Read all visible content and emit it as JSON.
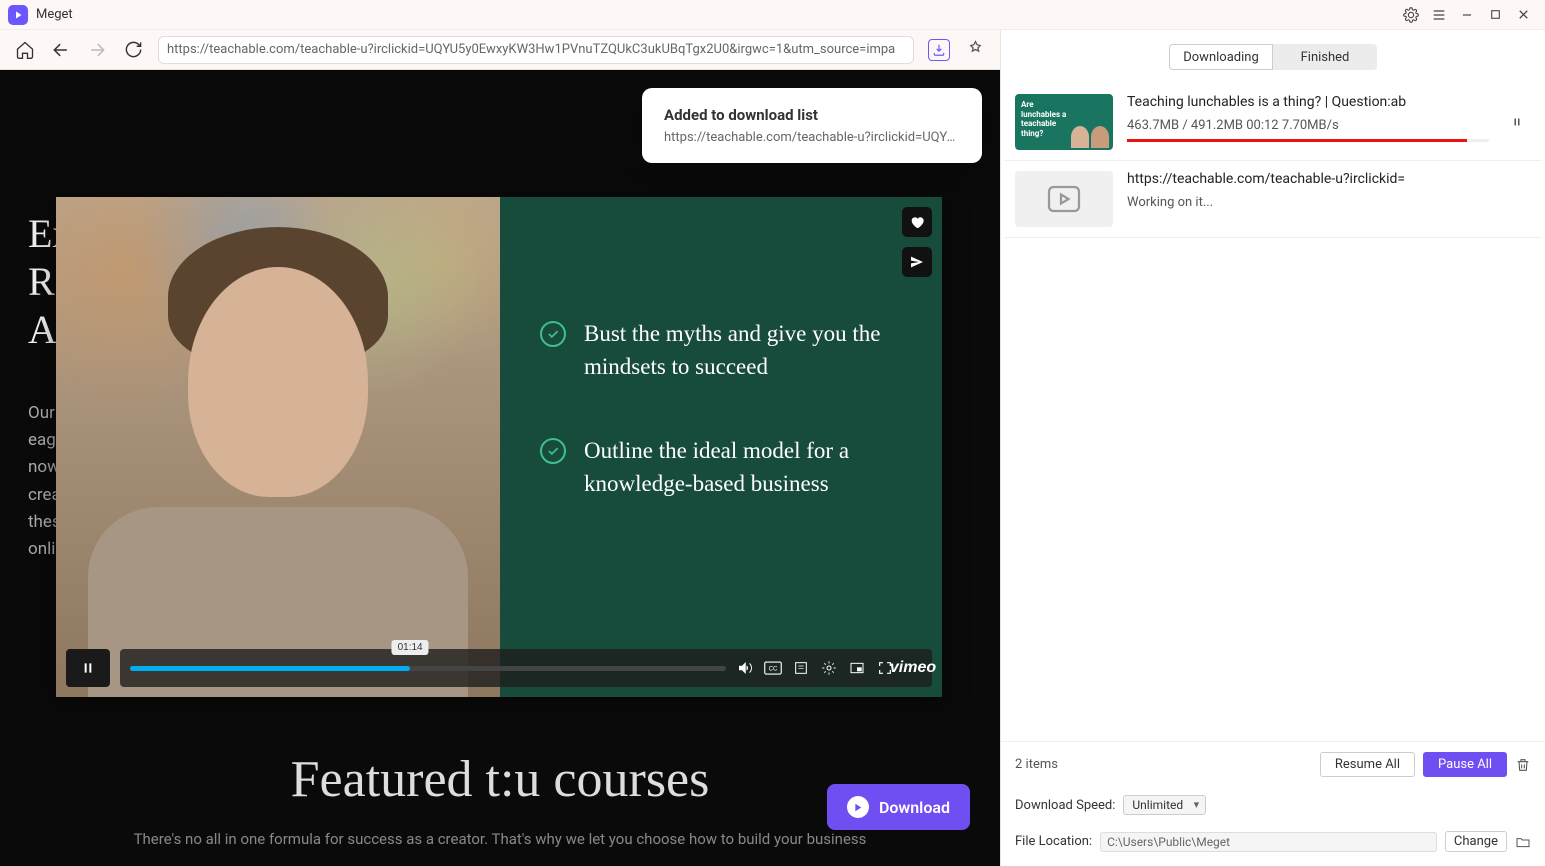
{
  "app": {
    "title": "Meget"
  },
  "toolbar": {
    "url": "https://teachable.com/teachable-u?irclickid=UQYU5y0EwxyKW3Hw1PVnuTZQUkC3ukUBqTgx2U0&irgwc=1&utm_source=impa"
  },
  "toast": {
    "title": "Added to download list",
    "url": "https://teachable.com/teachable-u?irclickid=UQYU5y..."
  },
  "page": {
    "heading_lines": [
      "Ex",
      "Re",
      "Ac"
    ],
    "body_lines": [
      "Our",
      "eage",
      "now",
      "crea",
      "thes",
      "onli"
    ],
    "featured": "Featured t:u courses",
    "subline": "There's no all in one formula for success as a creator. That's why we let you choose how to build your business"
  },
  "player": {
    "bullets": [
      "Bust the myths and give you the mindsets to succeed",
      "Outline the ideal model for a knowledge-based business"
    ],
    "time_bubble": "01:14",
    "brand": "vimeo",
    "progress_pct": 47
  },
  "fab": {
    "label": "Download"
  },
  "side": {
    "tabs": {
      "downloading": "Downloading",
      "finished": "Finished",
      "active": "downloading"
    },
    "items": [
      {
        "thumb_kind": "lunchables",
        "thumb_text": "Are lunchables a teachable thing?",
        "title": "Teaching lunchables is a thing? | Question:ab",
        "meta": "463.7MB / 491.2MB  00:12  7.70MB/s",
        "status": "running",
        "progress_pct": 94
      },
      {
        "thumb_kind": "generic",
        "title": "https://teachable.com/teachable-u?irclickid=",
        "meta": "Working on it...",
        "status": "pending"
      }
    ],
    "summary": {
      "count": "2 items",
      "resume": "Resume All",
      "pause": "Pause All"
    },
    "speed": {
      "label": "Download Speed:",
      "value": "Unlimited"
    },
    "loc": {
      "label": "File Location:",
      "value": "C:\\Users\\Public\\Meget",
      "change": "Change"
    }
  }
}
